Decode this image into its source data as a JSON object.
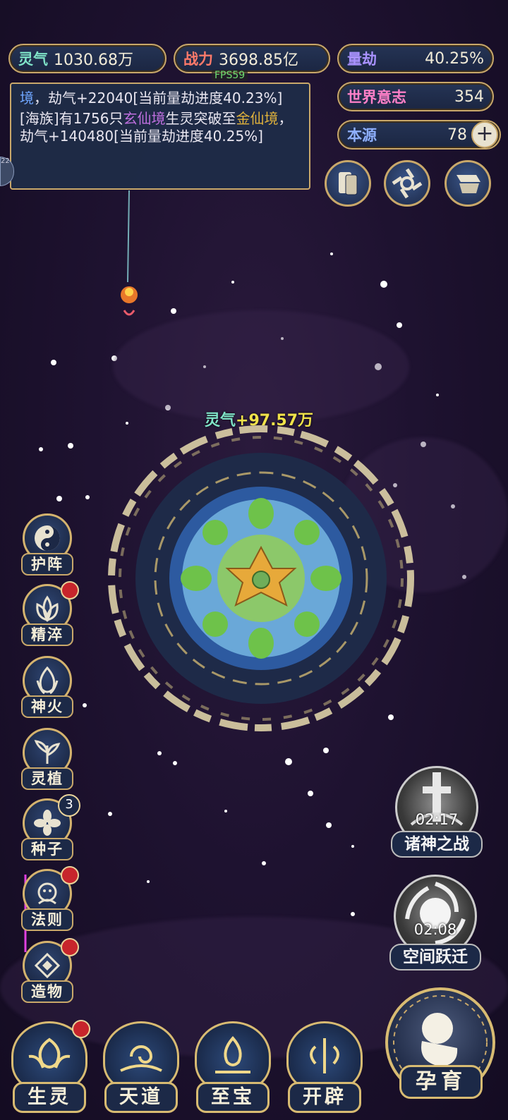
{
  "stats": {
    "lingqi": {
      "label": "灵气",
      "value": "1030.68万"
    },
    "zhanli": {
      "label": "战力",
      "value": "3698.85亿"
    },
    "liangjie": {
      "label": "量劫",
      "value": "40.25%"
    },
    "world_will": {
      "label": "世界意志",
      "value": "354"
    },
    "benyuan": {
      "label": "本源",
      "value": "78"
    }
  },
  "fps": "FPS59",
  "log": {
    "line1_a": "境",
    "line1_b": "，劫气+22040[当前量劫进度40.23%]",
    "line2_a": "[海族]有1756只",
    "line2_b": "玄仙境",
    "line2_c": "生灵突破至",
    "line2_d": "金仙境",
    "line2_e": "，劫气+140480[当前量劫进度40.25%]"
  },
  "side_tab": "22",
  "gain": {
    "label": "灵气",
    "value": "+97.57万"
  },
  "skills": [
    {
      "label": "护阵",
      "icon": "yin-yang-icon"
    },
    {
      "label": "精淬",
      "icon": "lotus-flame-icon"
    },
    {
      "label": "神火",
      "icon": "fire-icon"
    },
    {
      "label": "灵植",
      "icon": "plant-icon"
    },
    {
      "label": "种子",
      "icon": "seed-flower-icon",
      "badge": "3"
    },
    {
      "label": "法则",
      "icon": "law-beast-icon"
    },
    {
      "label": "造物",
      "icon": "creation-diamond-icon"
    }
  ],
  "events": [
    {
      "name": "诸神之战",
      "timer": "02:17"
    },
    {
      "name": "空间跃迁",
      "timer": "02:08"
    }
  ],
  "nav": [
    {
      "label": "生灵"
    },
    {
      "label": "天道"
    },
    {
      "label": "至宝"
    },
    {
      "label": "开辟"
    }
  ],
  "breed": {
    "label": "孕育"
  },
  "colors": {
    "gold": "#c9a86a",
    "panel": "#1c2947",
    "red_dot": "#c7252c",
    "gain_text": "#f0e24a"
  }
}
